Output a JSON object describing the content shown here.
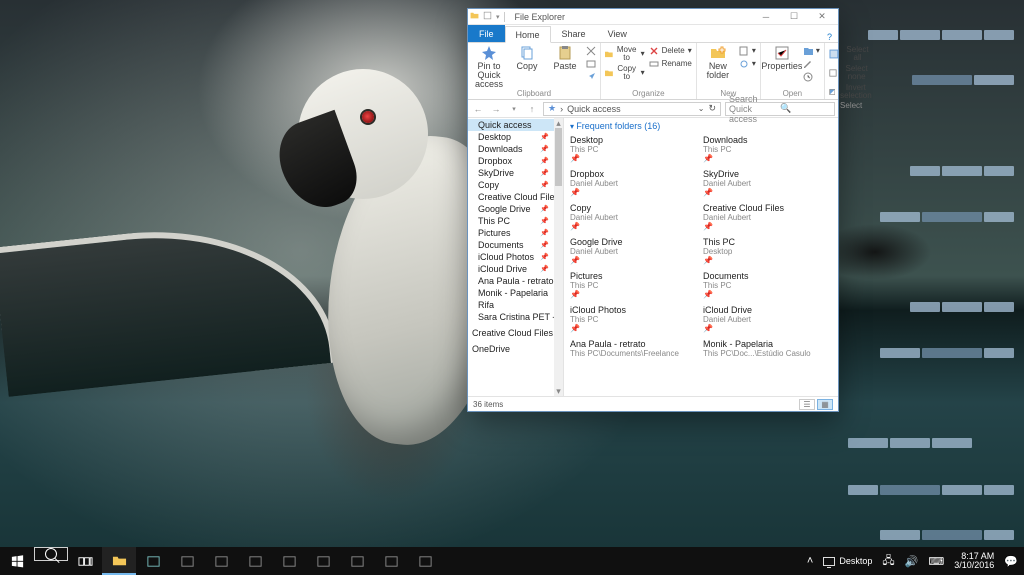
{
  "window": {
    "title": "File Explorer",
    "tabs": {
      "file": "File",
      "home": "Home",
      "share": "Share",
      "view": "View"
    },
    "help_icon": "help-icon"
  },
  "ribbon": {
    "clipboard": {
      "label": "Clipboard",
      "pin": "Pin to Quick access",
      "copy": "Copy",
      "paste": "Paste"
    },
    "organize": {
      "label": "Organize",
      "moveto": "Move to",
      "copyto": "Copy to",
      "delete": "Delete",
      "rename": "Rename"
    },
    "new": {
      "label": "New",
      "newfolder": "New folder"
    },
    "open": {
      "label": "Open",
      "properties": "Properties"
    },
    "select": {
      "label": "Select",
      "all": "Select all",
      "none": "Select none",
      "invert": "Invert selection"
    }
  },
  "addressbar": {
    "path": "Quick access",
    "sep": "›",
    "search_placeholder": "Search Quick access"
  },
  "sidebar": {
    "items": [
      {
        "label": "Quick access",
        "pinned": false,
        "selected": true
      },
      {
        "label": "Desktop",
        "pinned": true
      },
      {
        "label": "Downloads",
        "pinned": true
      },
      {
        "label": "Dropbox",
        "pinned": true
      },
      {
        "label": "SkyDrive",
        "pinned": true
      },
      {
        "label": "Copy",
        "pinned": true
      },
      {
        "label": "Creative Cloud Files",
        "pinned": true
      },
      {
        "label": "Google Drive",
        "pinned": true
      },
      {
        "label": "This PC",
        "pinned": true
      },
      {
        "label": "Pictures",
        "pinned": true
      },
      {
        "label": "Documents",
        "pinned": true
      },
      {
        "label": "iCloud Photos",
        "pinned": true
      },
      {
        "label": "iCloud Drive",
        "pinned": true
      },
      {
        "label": "Ana Paula - retrato",
        "pinned": false
      },
      {
        "label": "Monik - Papelaria",
        "pinned": false
      },
      {
        "label": "Rifa",
        "pinned": false
      },
      {
        "label": "Sara Cristina PET - Gusta",
        "pinned": false
      }
    ],
    "sections": [
      {
        "label": "Creative Cloud Files"
      },
      {
        "label": "OneDrive"
      }
    ]
  },
  "main": {
    "group_title": "Frequent folders (16)",
    "items": [
      {
        "t": "Desktop",
        "s": "This PC",
        "p": "📌"
      },
      {
        "t": "Downloads",
        "s": "This PC",
        "p": "📌"
      },
      {
        "t": "Dropbox",
        "s": "Daniel Aubert",
        "p": "📌"
      },
      {
        "t": "SkyDrive",
        "s": "Daniel Aubert",
        "p": "📌"
      },
      {
        "t": "Copy",
        "s": "Daniel Aubert",
        "p": "📌"
      },
      {
        "t": "Creative Cloud Files",
        "s": "Daniel Aubert",
        "p": "📌"
      },
      {
        "t": "Google Drive",
        "s": "Daniel Aubert",
        "p": "📌"
      },
      {
        "t": "This PC",
        "s": "Desktop",
        "p": "📌"
      },
      {
        "t": "Pictures",
        "s": "This PC",
        "p": "📌"
      },
      {
        "t": "Documents",
        "s": "This PC",
        "p": "📌"
      },
      {
        "t": "iCloud Photos",
        "s": "This PC",
        "p": "📌"
      },
      {
        "t": "iCloud Drive",
        "s": "Daniel Aubert",
        "p": "📌"
      },
      {
        "t": "Ana Paula - retrato",
        "s": "This PC\\Documents\\Freelance",
        "p": ""
      },
      {
        "t": "Monik - Papelaria",
        "s": "This PC\\Doc...\\Estúdio Casulo",
        "p": ""
      }
    ]
  },
  "statusbar": {
    "count": "36 items"
  },
  "taskbar": {
    "desktop_label": "Desktop",
    "time": "8:17 AM",
    "date": "3/10/2016"
  }
}
